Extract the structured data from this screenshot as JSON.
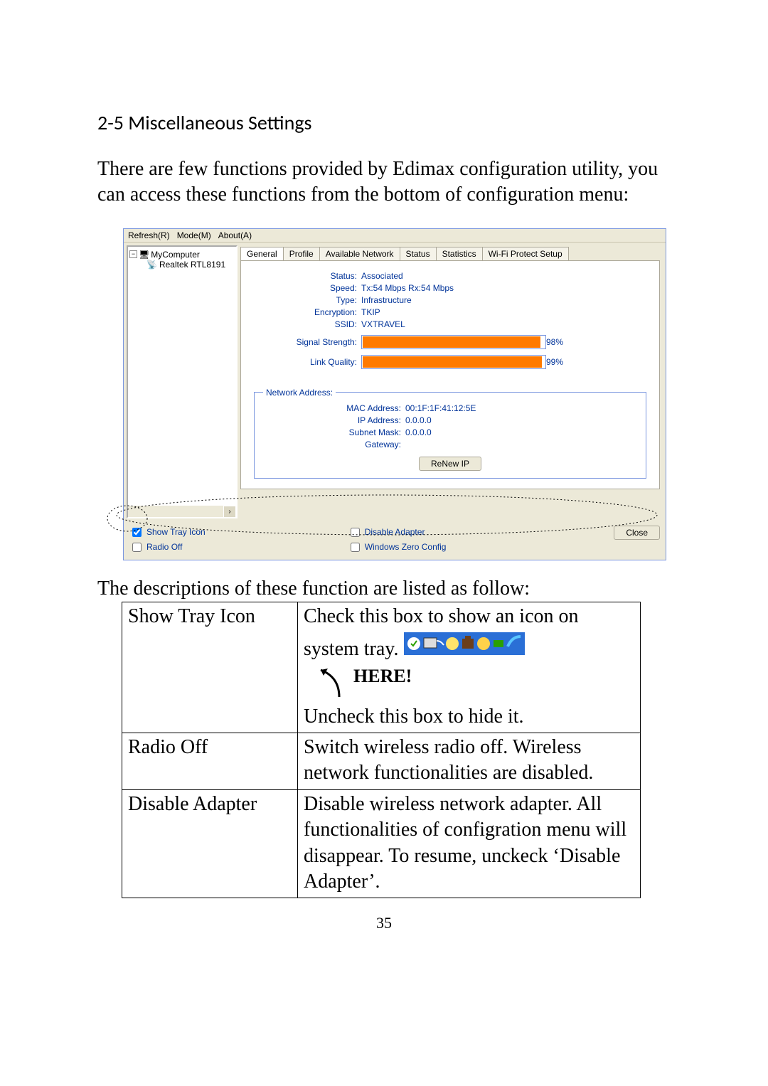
{
  "heading": "2-5 Miscellaneous Settings",
  "intro": "There are few functions provided by Edimax configuration utility, you can access these functions from the bottom of configuration menu:",
  "window": {
    "menu": {
      "refresh": "Refresh(R)",
      "mode": "Mode(M)",
      "about": "About(A)"
    },
    "tree": {
      "root": "MyComputer",
      "child": "Realtek RTL8191"
    },
    "tabs": [
      "General",
      "Profile",
      "Available Network",
      "Status",
      "Statistics",
      "Wi-Fi Protect Setup"
    ],
    "status": {
      "status_k": "Status:",
      "status_v": "Associated",
      "speed_k": "Speed:",
      "speed_v": "Tx:54 Mbps Rx:54 Mbps",
      "type_k": "Type:",
      "type_v": "Infrastructure",
      "enc_k": "Encryption:",
      "enc_v": "TKIP",
      "ssid_k": "SSID:",
      "ssid_v": "VXTRAVEL",
      "sig_k": "Signal Strength:",
      "sig_pct": "98%",
      "lq_k": "Link Quality:",
      "lq_pct": "99%"
    },
    "netaddr": {
      "legend": "Network Address:",
      "mac_k": "MAC Address:",
      "mac_v": "00:1F:1F:41:12:5E",
      "ip_k": "IP Address:",
      "ip_v": "0.0.0.0",
      "sm_k": "Subnet Mask:",
      "sm_v": "0.0.0.0",
      "gw_k": "Gateway:",
      "gw_v": "",
      "renew": "ReNew IP"
    },
    "bottom": {
      "show_tray": "Show Tray Icon",
      "radio_off": "Radio Off",
      "disable_adapter": "Disable Adapter",
      "win_zero": "Windows Zero Config",
      "close": "Close"
    }
  },
  "desc_intro": "The descriptions of these function are listed as follow:",
  "table": {
    "r1k": "Show Tray Icon",
    "r1v_line1": "Check this box to show an icon on system tray.",
    "r1_here": "HERE!",
    "r1v_line2": "Uncheck this box to hide it.",
    "r2k": "Radio Off",
    "r2v": "Switch wireless radio off. Wireless network functionalities are disabled.",
    "r3k": "Disable Adapter",
    "r3v": "Disable wireless network adapter. All functionalities of configration menu will disappear. To resume, unckeck ‘Disable Adapter’."
  },
  "pagenum": "35"
}
